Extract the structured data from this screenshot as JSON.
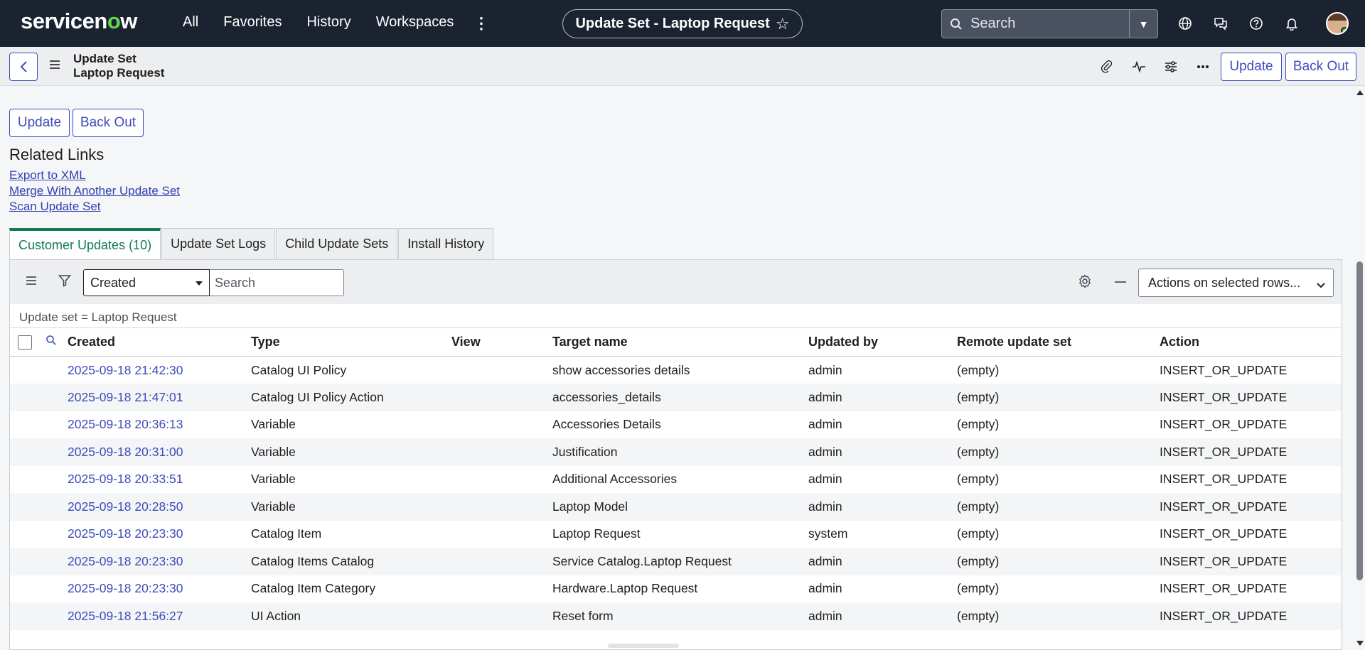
{
  "nav": {
    "logo": "servicenow",
    "links": [
      "All",
      "Favorites",
      "History",
      "Workspaces"
    ],
    "current_record": "Update Set - Laptop Request",
    "search_placeholder": "Search"
  },
  "form": {
    "title_line1": "Update Set",
    "title_line2": "Laptop Request",
    "update_label": "Update",
    "backout_label": "Back Out"
  },
  "related_links": {
    "title": "Related Links",
    "links": [
      "Export to XML",
      "Merge With Another Update Set",
      "Scan Update Set"
    ]
  },
  "tabs": [
    "Customer Updates (10)",
    "Update Set Logs",
    "Child Update Sets",
    "Install History"
  ],
  "list": {
    "filter_field": "Created",
    "search_placeholder": "Search",
    "actions_label": "Actions on selected rows...",
    "breadcrumb": "Update set = Laptop Request",
    "columns": [
      "Created",
      "Type",
      "View",
      "Target name",
      "Updated by",
      "Remote update set",
      "Action"
    ],
    "rows": [
      [
        "2025-09-18 21:42:30",
        "Catalog UI Policy",
        "",
        "show accessories details",
        "admin",
        "(empty)",
        "INSERT_OR_UPDATE"
      ],
      [
        "2025-09-18 21:47:01",
        "Catalog UI Policy Action",
        "",
        "accessories_details",
        "admin",
        "(empty)",
        "INSERT_OR_UPDATE"
      ],
      [
        "2025-09-18 20:36:13",
        "Variable",
        "",
        "Accessories Details",
        "admin",
        "(empty)",
        "INSERT_OR_UPDATE"
      ],
      [
        "2025-09-18 20:31:00",
        "Variable",
        "",
        "Justification",
        "admin",
        "(empty)",
        "INSERT_OR_UPDATE"
      ],
      [
        "2025-09-18 20:33:51",
        "Variable",
        "",
        "Additional Accessories",
        "admin",
        "(empty)",
        "INSERT_OR_UPDATE"
      ],
      [
        "2025-09-18 20:28:50",
        "Variable",
        "",
        "Laptop Model",
        "admin",
        "(empty)",
        "INSERT_OR_UPDATE"
      ],
      [
        "2025-09-18 20:23:30",
        "Catalog Item",
        "",
        "Laptop Request",
        "system",
        "(empty)",
        "INSERT_OR_UPDATE"
      ],
      [
        "2025-09-18 20:23:30",
        "Catalog Items Catalog",
        "",
        "Service Catalog.Laptop Request",
        "admin",
        "(empty)",
        "INSERT_OR_UPDATE"
      ],
      [
        "2025-09-18 20:23:30",
        "Catalog Item Category",
        "",
        "Hardware.Laptop Request",
        "admin",
        "(empty)",
        "INSERT_OR_UPDATE"
      ],
      [
        "2025-09-18 21:56:27",
        "UI Action",
        "",
        "Reset form",
        "admin",
        "(empty)",
        "INSERT_OR_UPDATE"
      ]
    ]
  },
  "colors": {
    "nav_bg": "#1c2330",
    "brand_green": "#62d84e",
    "accent_blue": "#3e4cbb",
    "active_tab": "#127a53"
  },
  "icons": {
    "top": [
      "search-icon",
      "globe-icon",
      "chat-icon",
      "help-icon",
      "bell-icon"
    ],
    "form": [
      "paperclip-icon",
      "activity-icon",
      "sliders-icon",
      "more-icon"
    ]
  }
}
